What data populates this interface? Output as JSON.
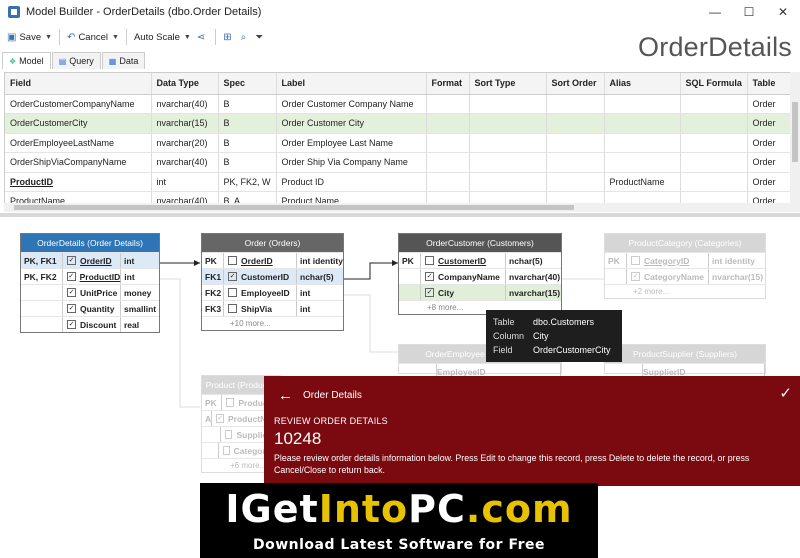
{
  "window": {
    "title": "Model Builder - OrderDetails (dbo.Order Details)",
    "controls": [
      "—",
      "☐",
      "✕"
    ]
  },
  "toolbar": {
    "save_label": "Save",
    "cancel_label": "Cancel",
    "autoscale_label": "Auto Scale"
  },
  "page_title": "OrderDetails",
  "tabs": [
    {
      "label": "Model"
    },
    {
      "label": "Query"
    },
    {
      "label": "Data"
    }
  ],
  "grid": {
    "columns": [
      "Field",
      "Data Type",
      "Spec",
      "Label",
      "Format",
      "Sort Type",
      "Sort Order",
      "Alias",
      "SQL Formula",
      "Table"
    ],
    "rows": [
      [
        "OrderCustomerCompanyName",
        "nvarchar(40)",
        "B",
        "Order Customer Company Name",
        "",
        "",
        "",
        "",
        "",
        "Order"
      ],
      [
        "OrderCustomerCity",
        "nvarchar(15)",
        "B",
        "Order Customer City",
        "",
        "",
        "",
        "",
        "",
        "Order"
      ],
      [
        "OrderEmployeeLastName",
        "nvarchar(20)",
        "B",
        "Order Employee Last Name",
        "",
        "",
        "",
        "",
        "",
        "Order"
      ],
      [
        "OrderShipViaCompanyName",
        "nvarchar(40)",
        "B",
        "Order Ship Via Company Name",
        "",
        "",
        "",
        "",
        "",
        "Order"
      ],
      [
        "ProductID",
        "int",
        "PK, FK2, W",
        "Product ID",
        "",
        "",
        "",
        "ProductName",
        "",
        "Order"
      ],
      [
        "ProductName",
        "nvarchar(40)",
        "B, A",
        "Product Name",
        "",
        "",
        "",
        "",
        "",
        "Order"
      ]
    ]
  },
  "diagram": {
    "order_details": {
      "title": "OrderDetails (Order Details)",
      "rows": [
        {
          "key": "PK, FK1",
          "checked": "✓",
          "name": "OrderID",
          "type": "int"
        },
        {
          "key": "PK, FK2",
          "checked": "✓",
          "name": "ProductID",
          "type": "int"
        },
        {
          "key": "",
          "checked": "✓",
          "name": "UnitPrice",
          "type": "money"
        },
        {
          "key": "",
          "checked": "✓",
          "name": "Quantity",
          "type": "smallint"
        },
        {
          "key": "",
          "checked": "✓",
          "name": "Discount",
          "type": "real"
        }
      ]
    },
    "order": {
      "title": "Order (Orders)",
      "rows": [
        {
          "key": "PK",
          "checked": "",
          "name": "OrderID",
          "type": "int identity"
        },
        {
          "key": "FK1",
          "checked": "✓",
          "name": "CustomerID",
          "type": "nchar(5)"
        },
        {
          "key": "FK2",
          "checked": "",
          "name": "EmployeeID",
          "type": "int"
        },
        {
          "key": "FK3",
          "checked": "",
          "name": "ShipVia",
          "type": "int"
        }
      ],
      "more": "+10 more..."
    },
    "order_customer": {
      "title": "OrderCustomer (Customers)",
      "rows": [
        {
          "key": "PK",
          "checked": "",
          "name": "CustomerID",
          "type": "nchar(5)"
        },
        {
          "key": "",
          "checked": "✓",
          "name": "CompanyName",
          "type": "nvarchar(40)"
        },
        {
          "key": "",
          "checked": "✓",
          "name": "City",
          "type": "nvarchar(15)"
        }
      ],
      "more": "+8 more..."
    },
    "product_category": {
      "title": "ProductCategory (Categories)",
      "rows": [
        {
          "key": "PK",
          "checked": "",
          "name": "CategoryID",
          "type": "int identity"
        },
        {
          "key": "",
          "checked": "✓",
          "name": "CategoryName",
          "type": "nvarchar(15)"
        }
      ],
      "more": "+2 more..."
    },
    "order_employee": {
      "title": "OrderEmployee (Employees)",
      "first": "EmployeeID"
    },
    "product_supplier": {
      "title": "ProductSupplier (Suppliers)",
      "first": "SupplierID"
    },
    "product": {
      "title": "Product (Products)",
      "rows": [
        {
          "key": "PK",
          "checked": "",
          "name": "ProductID",
          "type": ""
        },
        {
          "key": "A",
          "checked": "✓",
          "name": "ProductName",
          "type": ""
        },
        {
          "key": "",
          "checked": "",
          "name": "SupplierID",
          "type": ""
        },
        {
          "key": "",
          "checked": "",
          "name": "CategoryID",
          "type": ""
        }
      ],
      "more": "+6 more..."
    }
  },
  "tooltip": {
    "rows": [
      {
        "label": "Table",
        "value": "dbo.Customers"
      },
      {
        "label": "Column",
        "value": "City"
      },
      {
        "label": "Field",
        "value": "OrderCustomerCity"
      }
    ]
  },
  "overlay": {
    "header": "Order Details",
    "label": "REVIEW ORDER DETAILS",
    "record_id": "10248",
    "message": "Please review order details information below. Press Edit to change this record, press Delete to delete the record, or press Cancel/Close to return back."
  },
  "banner": {
    "main_1": "IGet",
    "main_2": "Into",
    "main_3": "PC",
    "main_4": ".com",
    "sub": "Download Latest Software for Free"
  },
  "colors": {
    "entity_header": "#2e75b6",
    "entity_header_dark": "#666666",
    "overlay_bg": "#7a0a0f",
    "selected_row": "#e3f1dc"
  }
}
